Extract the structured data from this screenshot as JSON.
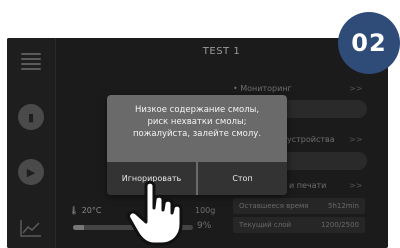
{
  "title": "TEST 1",
  "step_badge": "02",
  "monitoring_label": "• Мониторинг",
  "device_label": "устройства",
  "print_label": "и печати",
  "temperature": "20°C",
  "layer_partial": "100g",
  "progress": {
    "label": "9%",
    "value": 0.09
  },
  "info": {
    "remaining_label": "Оставшееся время",
    "remaining_value": "5h12min",
    "layer_label": "Текущий слой",
    "layer_value": "1200/2500"
  },
  "dialog": {
    "message": [
      "Низкое содержание смолы,",
      "риск нехватки смолы;",
      "пожалуйста, залейте смолу."
    ],
    "ignore_button": "Игнорировать",
    "stop_button": "Стоп"
  },
  "icons": [
    "list-icon",
    "bookmark-icon",
    "play-icon",
    "chart-icon",
    "thermometer-icon",
    "hand-pointer-icon",
    "chevron-right-icon"
  ],
  "colors": {
    "badge": "#2f4b77",
    "dialog": "#6a6a6a",
    "button": "#333333",
    "screen": "#1b1b1b"
  }
}
